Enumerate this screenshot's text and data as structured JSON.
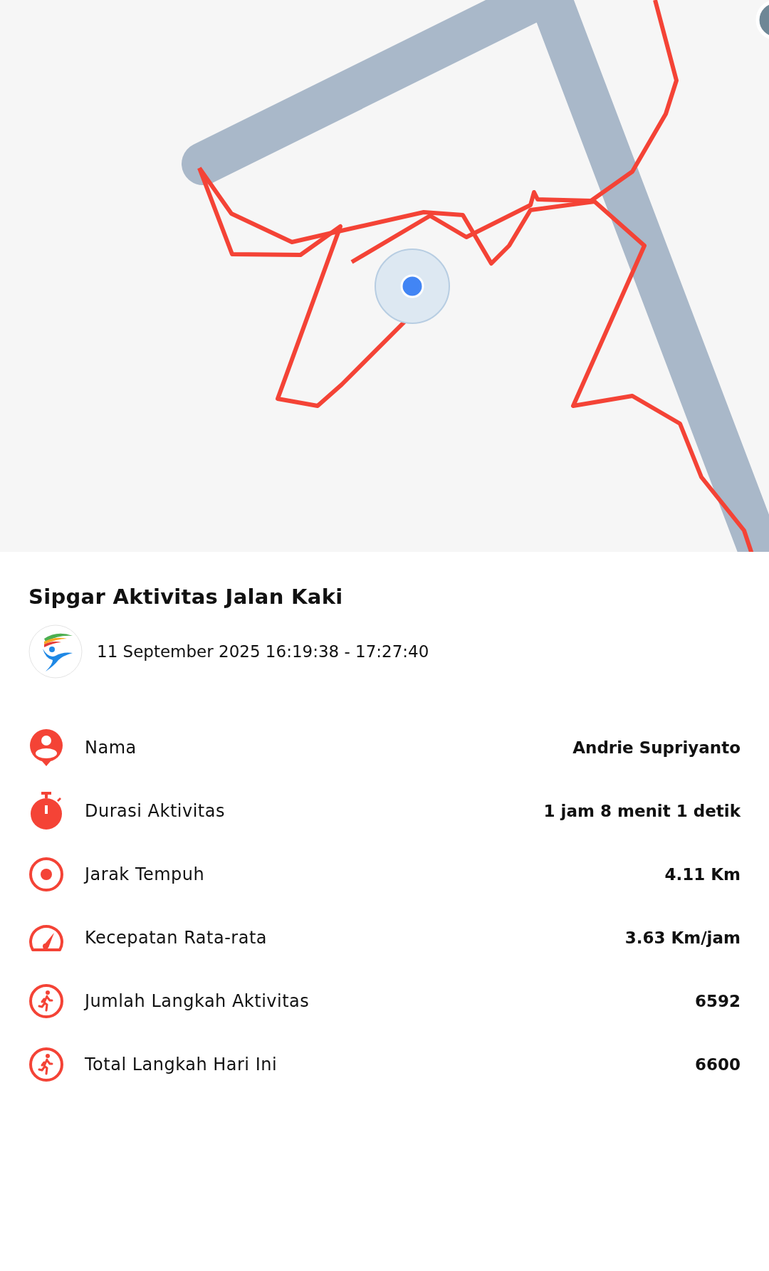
{
  "title": "Sipgar Aktivitas Jalan Kaki",
  "date_range": "11 September 2025 16:19:38 - 17:27:40",
  "stats": [
    {
      "kind": "person",
      "label": "Nama",
      "value": "Andrie Supriyanto"
    },
    {
      "kind": "timer",
      "label": "Durasi Aktivitas",
      "value": "1 jam 8 menit 1 detik"
    },
    {
      "kind": "distance",
      "label": "Jarak Tempuh",
      "value": "4.11 Km"
    },
    {
      "kind": "speed",
      "label": "Kecepatan Rata-rata",
      "value": "3.63 Km/jam"
    },
    {
      "kind": "steps",
      "label": "Jumlah Langkah Aktivitas",
      "value": "6592"
    },
    {
      "kind": "steps",
      "label": "Total Langkah Hari Ini",
      "value": "6600"
    }
  ]
}
